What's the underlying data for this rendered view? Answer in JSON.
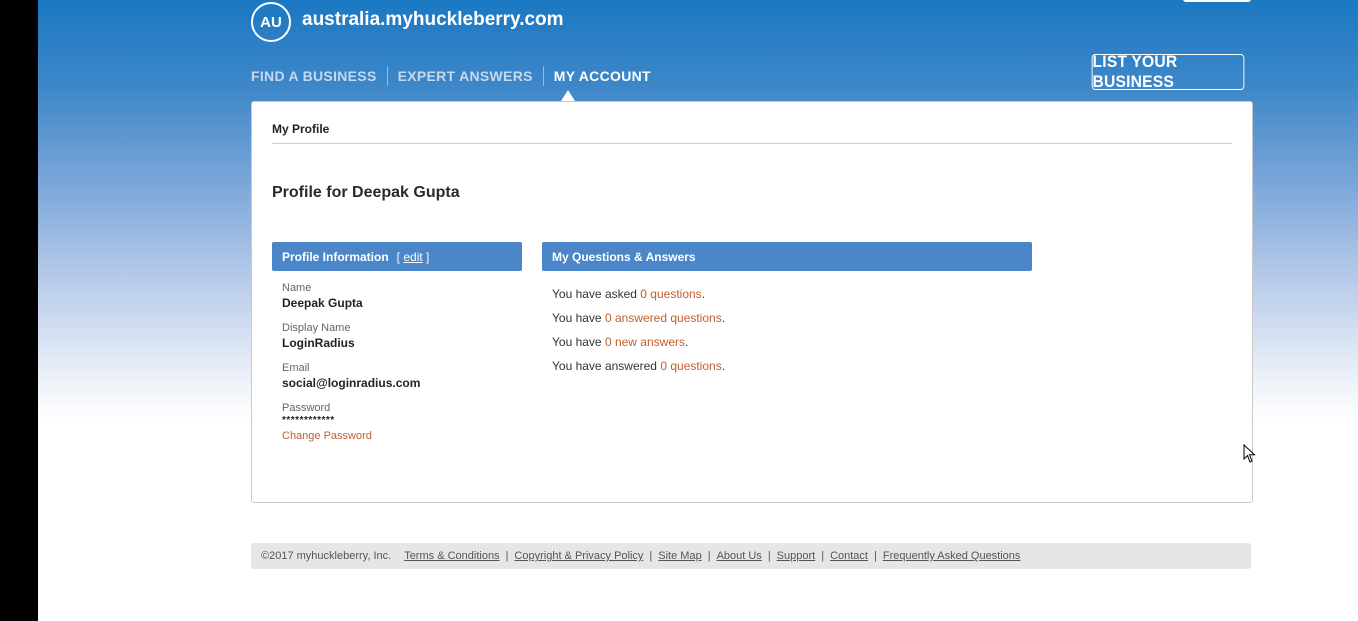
{
  "header": {
    "logo_badge": "AU",
    "site_name": "australia.myhuckleberry.com",
    "nav": [
      "FIND A BUSINESS",
      "EXPERT ANSWERS",
      "MY ACCOUNT"
    ],
    "cta": "LIST YOUR BUSINESS"
  },
  "main": {
    "breadcrumb": "My Profile",
    "title": "Profile for Deepak Gupta",
    "profile_box": {
      "heading": "Profile Information",
      "edit_open": "[ ",
      "edit": "edit",
      "edit_close": " ]",
      "name_label": "Name",
      "name": "Deepak Gupta",
      "display_label": "Display Name",
      "display_name": "LoginRadius",
      "email_label": "Email",
      "email": "social@loginradius.com",
      "password_label": "Password",
      "password": "************",
      "change_password": "Change Password"
    },
    "qa_box": {
      "heading": "My Questions & Answers",
      "lines": [
        {
          "pre": "You have asked ",
          "link": "0 questions",
          "post": "."
        },
        {
          "pre": "You have ",
          "link": "0 answered questions",
          "post": "."
        },
        {
          "pre": "You have ",
          "link": "0 new answers",
          "post": "."
        },
        {
          "pre": "You have answered ",
          "link": "0 questions",
          "post": "."
        }
      ]
    }
  },
  "footer": {
    "copyright": "©2017 myhuckleberry, Inc.",
    "links": [
      "Terms & Conditions",
      "Copyright & Privacy Policy",
      "Site Map",
      "About Us",
      "Support",
      "Contact",
      "Frequently Asked Questions"
    ]
  },
  "colors": {
    "header_blue": "#1a78c2",
    "box_header": "#4a86c8",
    "link_orange": "#c0602b"
  }
}
